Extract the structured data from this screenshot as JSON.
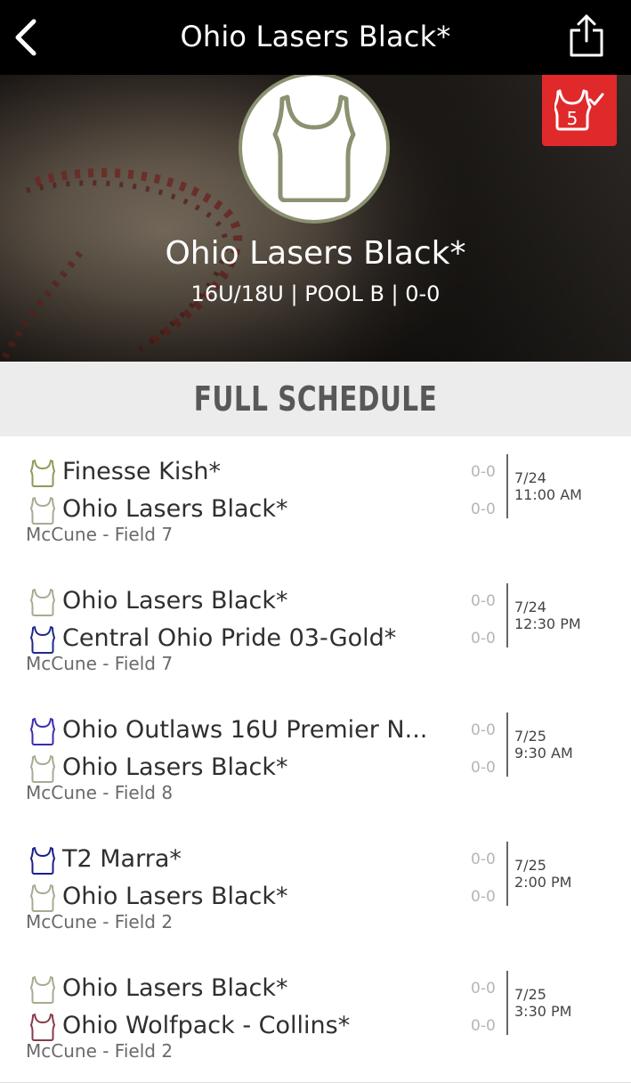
{
  "nav": {
    "title": "Ohio Lasers Black*",
    "back_icon": "chevron-left-icon",
    "share_icon": "share-icon"
  },
  "hero": {
    "team_name": "Ohio Lasers Black*",
    "subtitle": "16U/18U | POOL B | 0-0",
    "logo_icon": "jersey-icon",
    "badge_number": "5",
    "badge_icon": "jersey-check-icon",
    "badge_color": "#e0292b"
  },
  "schedule": {
    "header": "FULL SCHEDULE",
    "games": [
      {
        "team1": {
          "name": "Finesse Kish*",
          "score": "0-0",
          "jersey_color": "#8e9a5a"
        },
        "team2": {
          "name": "Ohio Lasers Black*",
          "score": "0-0",
          "jersey_color": "#a8ab92"
        },
        "date": "7/24",
        "time": "11:00 AM",
        "venue": "McCune - Field 7"
      },
      {
        "team1": {
          "name": "Ohio Lasers Black*",
          "score": "0-0",
          "jersey_color": "#a8ab92"
        },
        "team2": {
          "name": "Central Ohio Pride 03-Gold*",
          "score": "0-0",
          "jersey_color": "#1e2a8a"
        },
        "date": "7/24",
        "time": "12:30 PM",
        "venue": "McCune - Field 7"
      },
      {
        "team1": {
          "name": "Ohio Outlaws 16U Premier N...",
          "score": "0-0",
          "jersey_color": "#3a2db0"
        },
        "team2": {
          "name": "Ohio Lasers Black*",
          "score": "0-0",
          "jersey_color": "#a8ab92"
        },
        "date": "7/25",
        "time": "9:30 AM",
        "venue": "McCune - Field 8"
      },
      {
        "team1": {
          "name": "T2 Marra*",
          "score": "0-0",
          "jersey_color": "#1a1f8a"
        },
        "team2": {
          "name": "Ohio Lasers Black*",
          "score": "0-0",
          "jersey_color": "#a8ab92"
        },
        "date": "7/25",
        "time": "2:00 PM",
        "venue": "McCune - Field 2"
      },
      {
        "team1": {
          "name": "Ohio Lasers Black*",
          "score": "0-0",
          "jersey_color": "#a8ab92"
        },
        "team2": {
          "name": "Ohio Wolfpack - Collins*",
          "score": "0-0",
          "jersey_color": "#8a3a4a"
        },
        "date": "7/25",
        "time": "3:30 PM",
        "venue": "McCune - Field 2"
      }
    ]
  }
}
